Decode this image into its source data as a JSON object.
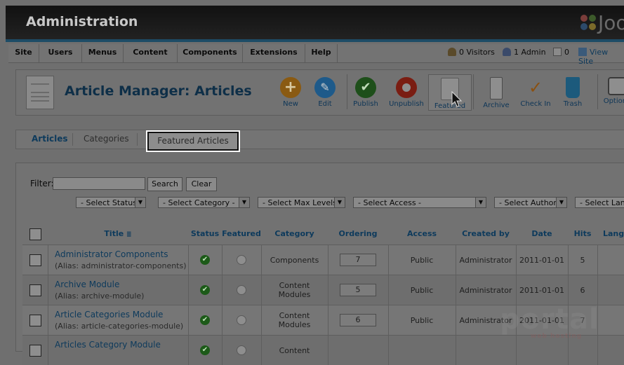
{
  "header": {
    "title": "Administration",
    "logo_text": "Joo"
  },
  "menu": [
    "Site",
    "Users",
    "Menus",
    "Content",
    "Components",
    "Extensions",
    "Help"
  ],
  "status": {
    "visitors": "0 Visitors",
    "admins": "1 Admin",
    "messages": "0",
    "view_site": "View Site"
  },
  "page_title": "Article Manager: Articles",
  "toolbar": {
    "new": "New",
    "edit": "Edit",
    "publish": "Publish",
    "unpublish": "Unpublish",
    "featured": "Featured",
    "archive": "Archive",
    "checkin": "Check In",
    "trash": "Trash",
    "options": "Options"
  },
  "subnav": {
    "articles": "Articles",
    "categories": "Categories",
    "featured": "Featured Articles"
  },
  "filter": {
    "label": "Filter:",
    "search": "Search",
    "clear": "Clear",
    "selects": [
      "- Select Status -",
      "- Select Category -",
      "- Select Max Levels -",
      "- Select Access -",
      "- Select Author -",
      "- Select Language -"
    ]
  },
  "table": {
    "headers": [
      "Title",
      "Status",
      "Featured",
      "Category",
      "Ordering",
      "Access",
      "Created by",
      "Date",
      "Hits",
      "Langu"
    ],
    "rows": [
      {
        "title": "Administrator Components",
        "alias": "(Alias: administrator-components)",
        "category": "Components",
        "ordering": "7",
        "access": "Public",
        "created_by": "Administrator",
        "date": "2011-01-01",
        "hits": "5"
      },
      {
        "title": "Archive Module",
        "alias": "(Alias: archive-module)",
        "category": "Content Modules",
        "ordering": "5",
        "access": "Public",
        "created_by": "Administrator",
        "date": "2011-01-01",
        "hits": "6"
      },
      {
        "title": "Article Categories Module",
        "alias": "(Alias: article-categories-module)",
        "category": "Content Modules",
        "ordering": "6",
        "access": "Public",
        "created_by": "Administrator",
        "date": "2011-01-01",
        "hits": "7"
      },
      {
        "title": "Articles Category Module",
        "alias": "",
        "category": "Content",
        "ordering": "",
        "access": "",
        "created_by": "",
        "date": "",
        "hits": ""
      }
    ]
  },
  "watermark": {
    "main": "portal",
    "sub": "web hosting"
  },
  "colors": {
    "accent": "#0d3a5c",
    "header_bg": "#111111",
    "blue_bar": "#1d4c66"
  }
}
